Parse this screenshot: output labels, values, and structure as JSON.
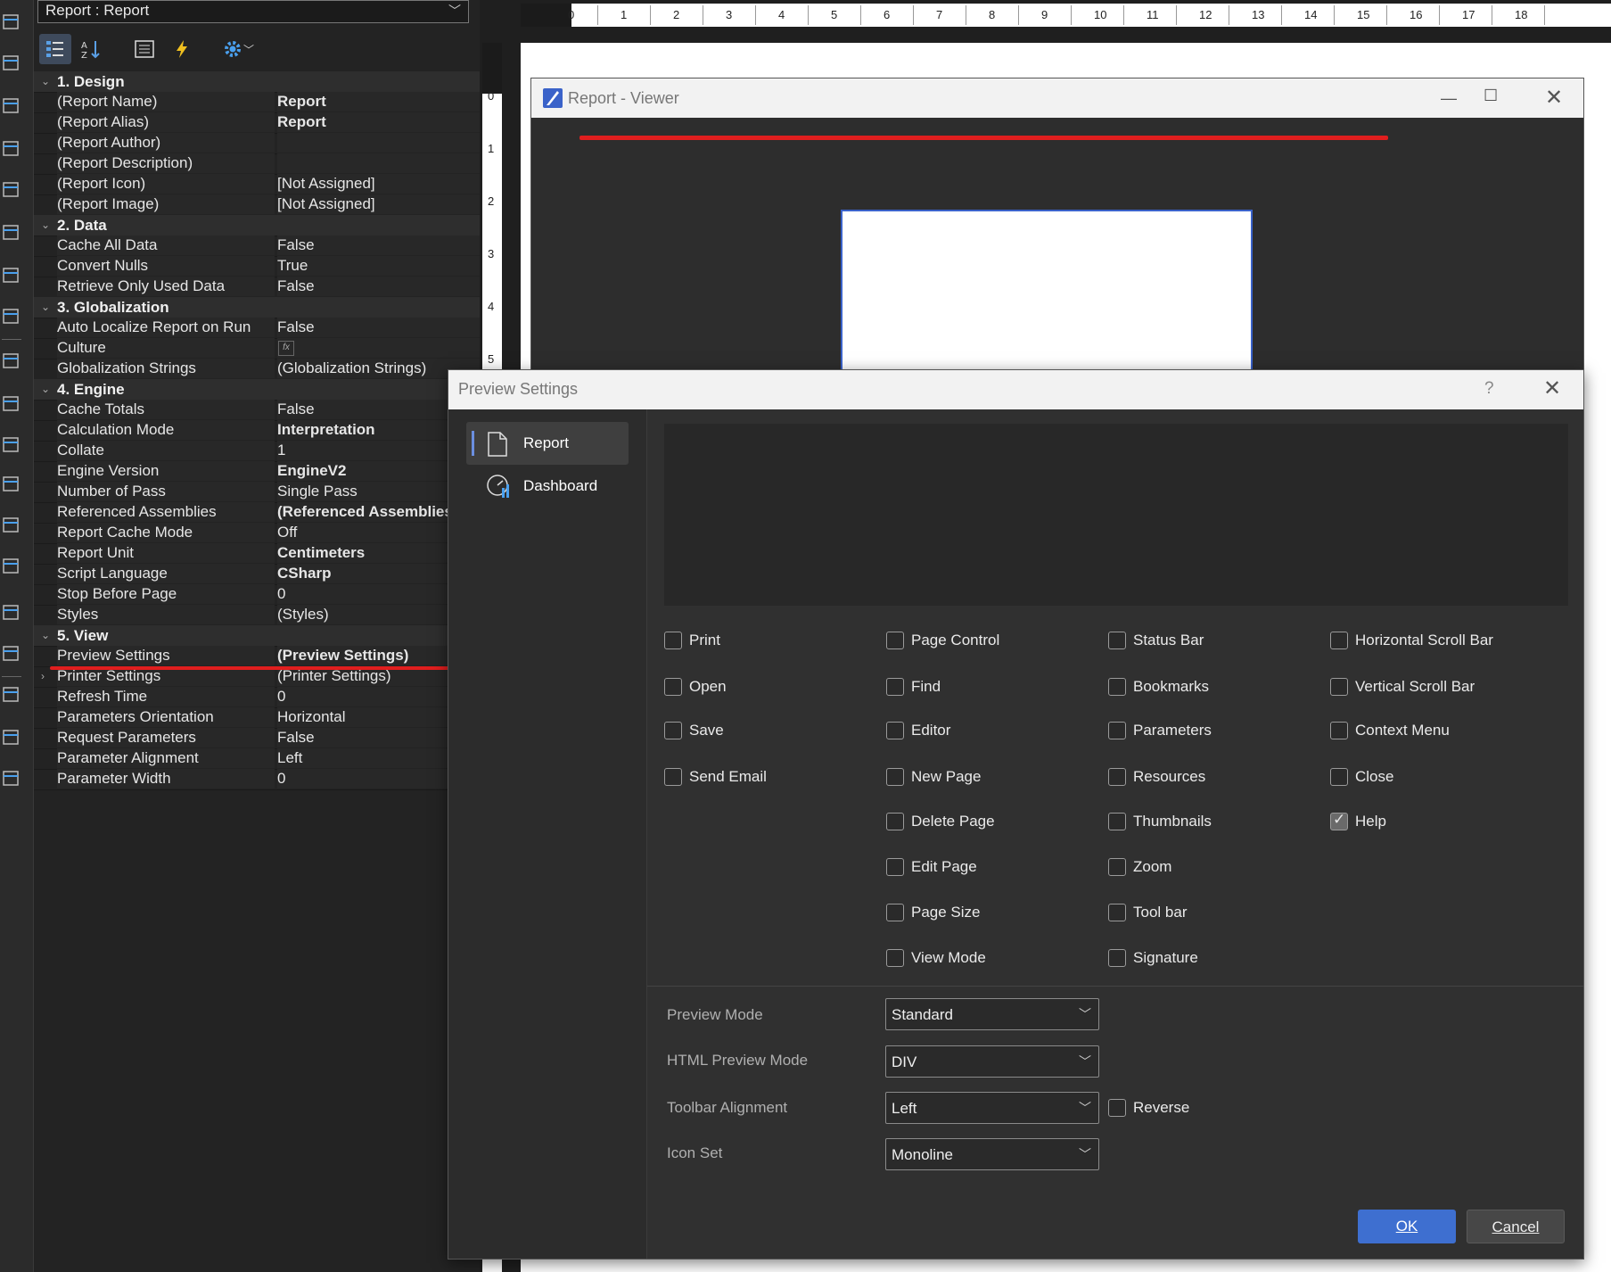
{
  "object_selector": {
    "text": "Report : Report"
  },
  "property_grid": {
    "categories": [
      {
        "title": "1. Design",
        "rows": [
          {
            "k": "(Report Name)",
            "v": "Report",
            "bold": true
          },
          {
            "k": "(Report Alias)",
            "v": "Report",
            "bold": true
          },
          {
            "k": "(Report Author)",
            "v": ""
          },
          {
            "k": "(Report Description)",
            "v": ""
          },
          {
            "k": "(Report Icon)",
            "v": "[Not Assigned]"
          },
          {
            "k": "(Report Image)",
            "v": "[Not Assigned]"
          }
        ]
      },
      {
        "title": "2. Data",
        "rows": [
          {
            "k": "Cache All Data",
            "v": "False"
          },
          {
            "k": "Convert Nulls",
            "v": "True"
          },
          {
            "k": "Retrieve Only Used Data",
            "v": "False"
          }
        ]
      },
      {
        "title": "3. Globalization",
        "rows": [
          {
            "k": "Auto Localize Report on Run",
            "v": "False"
          },
          {
            "k": "Culture",
            "v": "",
            "fx": true
          },
          {
            "k": "Globalization Strings",
            "v": "(Globalization Strings)"
          }
        ]
      },
      {
        "title": "4. Engine",
        "rows": [
          {
            "k": "Cache Totals",
            "v": "False"
          },
          {
            "k": "Calculation Mode",
            "v": "Interpretation",
            "bold": true
          },
          {
            "k": "Collate",
            "v": "1"
          },
          {
            "k": "Engine Version",
            "v": "EngineV2",
            "bold": true
          },
          {
            "k": "Number of Pass",
            "v": "Single Pass"
          },
          {
            "k": "Referenced Assemblies",
            "v": "(Referenced Assemblies)",
            "bold": true
          },
          {
            "k": "Report Cache Mode",
            "v": "Off"
          },
          {
            "k": "Report Unit",
            "v": "Centimeters",
            "bold": true
          },
          {
            "k": "Script Language",
            "v": "CSharp",
            "bold": true
          },
          {
            "k": "Stop Before Page",
            "v": "0"
          },
          {
            "k": "Styles",
            "v": "(Styles)"
          }
        ]
      },
      {
        "title": "5. View",
        "rows": [
          {
            "k": "Preview Settings",
            "v": "(Preview Settings)",
            "bold": true
          },
          {
            "k": "Printer Settings",
            "v": "(Printer Settings)",
            "expandable": true
          },
          {
            "k": "Refresh Time",
            "v": "0"
          },
          {
            "k": "Parameters Orientation",
            "v": "Horizontal"
          },
          {
            "k": "Request Parameters",
            "v": "False"
          },
          {
            "k": "Parameter Alignment",
            "v": "Left"
          },
          {
            "k": "Parameter Width",
            "v": "0"
          }
        ]
      }
    ]
  },
  "ruler": {
    "h_ticks": [
      "0",
      "1",
      "2",
      "3",
      "4",
      "5",
      "6",
      "7",
      "8",
      "9",
      "10",
      "11",
      "12",
      "13",
      "14",
      "15",
      "16",
      "17",
      "18"
    ],
    "v_ticks": [
      "0",
      "1",
      "2",
      "3",
      "4",
      "5"
    ]
  },
  "viewer": {
    "title": "Report - Viewer"
  },
  "dialog": {
    "title": "Preview Settings",
    "help": "?",
    "nav": [
      {
        "label": "Report",
        "selected": true
      },
      {
        "label": "Dashboard",
        "selected": false
      }
    ],
    "checkboxes": [
      {
        "label": "Print",
        "checked": false
      },
      {
        "label": "Open",
        "checked": false
      },
      {
        "label": "Save",
        "checked": false
      },
      {
        "label": "Send Email",
        "checked": false
      },
      {
        "label": "Page Control",
        "checked": false
      },
      {
        "label": "Find",
        "checked": false
      },
      {
        "label": "Editor",
        "checked": false
      },
      {
        "label": "New Page",
        "checked": false
      },
      {
        "label": "Delete Page",
        "checked": false
      },
      {
        "label": "Edit Page",
        "checked": false
      },
      {
        "label": "Page Size",
        "checked": false
      },
      {
        "label": "View Mode",
        "checked": false
      },
      {
        "label": "Status Bar",
        "checked": false
      },
      {
        "label": "Bookmarks",
        "checked": false
      },
      {
        "label": "Parameters",
        "checked": false
      },
      {
        "label": "Resources",
        "checked": false
      },
      {
        "label": "Thumbnails",
        "checked": false
      },
      {
        "label": "Zoom",
        "checked": false
      },
      {
        "label": "Tool bar",
        "checked": false
      },
      {
        "label": "Signature",
        "checked": false
      },
      {
        "label": "Horizontal Scroll Bar",
        "checked": false
      },
      {
        "label": "Vertical Scroll Bar",
        "checked": false
      },
      {
        "label": "Context Menu",
        "checked": false
      },
      {
        "label": "Close",
        "checked": false
      },
      {
        "label": "Help",
        "checked": true
      }
    ],
    "fields": {
      "preview_mode": {
        "label": "Preview Mode",
        "value": "Standard"
      },
      "html_preview_mode": {
        "label": "HTML Preview Mode",
        "value": "DIV"
      },
      "toolbar_alignment": {
        "label": "Toolbar Alignment",
        "value": "Left"
      },
      "reverse": {
        "label": "Reverse",
        "checked": false
      },
      "icon_set": {
        "label": "Icon Set",
        "value": "Monoline"
      }
    },
    "ok": "OK",
    "cancel": "Cancel"
  },
  "colors": {
    "accent": "#3e6fd0",
    "highlight_underline": "#e01e1e"
  }
}
